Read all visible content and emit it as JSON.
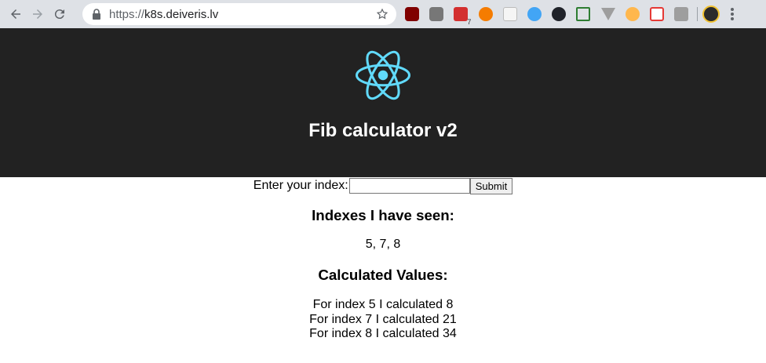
{
  "browser": {
    "url_scheme": "https://",
    "url_host": "k8s.deiveris.lv",
    "extension_badge": "7"
  },
  "app": {
    "title": "Fib calculator v2"
  },
  "form": {
    "label": "Enter your index:",
    "input_value": "",
    "submit_label": "Submit"
  },
  "seen": {
    "heading": "Indexes I have seen:",
    "values": "5, 7, 8"
  },
  "calculated": {
    "heading": "Calculated Values:",
    "items": [
      "For index 5 I calculated 8",
      "For index 7 I calculated 21",
      "For index 8 I calculated 34"
    ]
  },
  "colors": {
    "header_bg": "#222222",
    "react_logo": "#61dafb",
    "chrome_bg": "#dee1e6"
  }
}
